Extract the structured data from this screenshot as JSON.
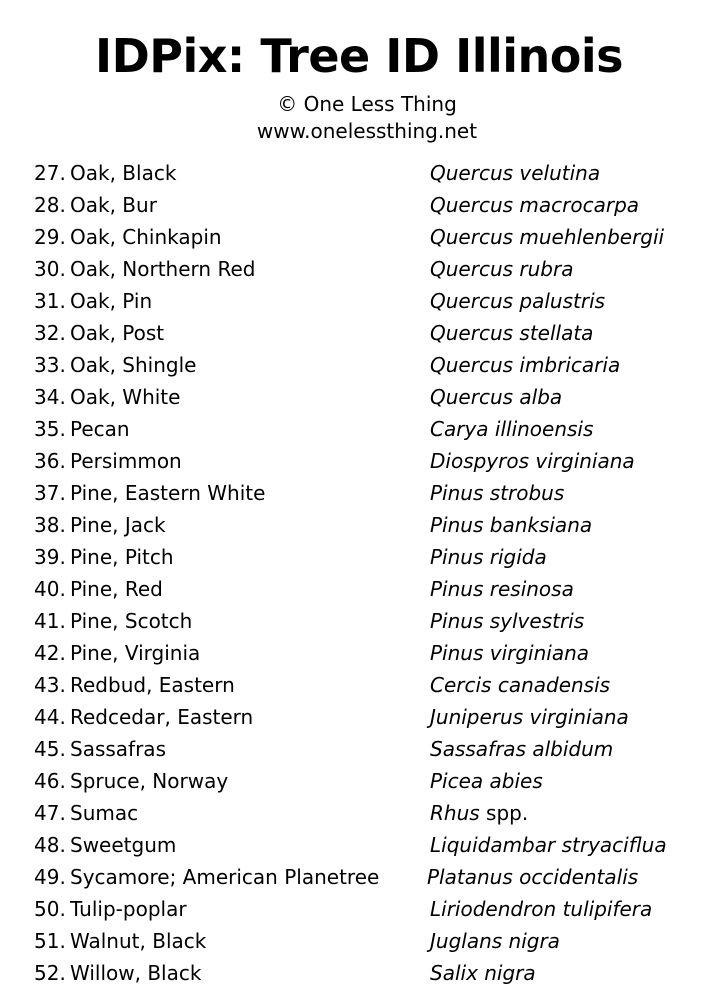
{
  "header": {
    "title": "IDPix: Tree ID Illinois",
    "copyright": "© One Less Thing",
    "website": "www.onelessthing.net"
  },
  "trees": [
    {
      "number": "27.",
      "common": "Oak, Black",
      "scientific": "Quercus velutina",
      "scientific_suffix": ""
    },
    {
      "number": "28.",
      "common": "Oak, Bur",
      "scientific": "Quercus macrocarpa",
      "scientific_suffix": ""
    },
    {
      "number": "29.",
      "common": "Oak, Chinkapin",
      "scientific": "Quercus muehlenbergii",
      "scientific_suffix": ""
    },
    {
      "number": "30.",
      "common": "Oak, Northern Red",
      "scientific": "Quercus rubra",
      "scientific_suffix": ""
    },
    {
      "number": "31.",
      "common": "Oak, Pin",
      "scientific": "Quercus palustris",
      "scientific_suffix": ""
    },
    {
      "number": "32.",
      "common": "Oak, Post",
      "scientific": "Quercus stellata",
      "scientific_suffix": ""
    },
    {
      "number": "33.",
      "common": "Oak, Shingle",
      "scientific": "Quercus imbricaria",
      "scientific_suffix": ""
    },
    {
      "number": "34.",
      "common": "Oak, White",
      "scientific": "Quercus alba",
      "scientific_suffix": ""
    },
    {
      "number": "35.",
      "common": "Pecan",
      "scientific": "Carya illinoensis",
      "scientific_suffix": ""
    },
    {
      "number": "36.",
      "common": "Persimmon",
      "scientific": "Diospyros virginiana",
      "scientific_suffix": ""
    },
    {
      "number": "37.",
      "common": "Pine, Eastern White",
      "scientific": "Pinus strobus",
      "scientific_suffix": ""
    },
    {
      "number": "38.",
      "common": "Pine, Jack",
      "scientific": "Pinus banksiana",
      "scientific_suffix": ""
    },
    {
      "number": "39.",
      "common": "Pine, Pitch",
      "scientific": "Pinus rigida",
      "scientific_suffix": ""
    },
    {
      "number": "40.",
      "common": "Pine, Red",
      "scientific": "Pinus resinosa",
      "scientific_suffix": ""
    },
    {
      "number": "41.",
      "common": "Pine, Scotch",
      "scientific": "Pinus sylvestris",
      "scientific_suffix": ""
    },
    {
      "number": "42.",
      "common": "Pine, Virginia",
      "scientific": "Pinus virginiana",
      "scientific_suffix": ""
    },
    {
      "number": "43.",
      "common": "Redbud, Eastern",
      "scientific": "Cercis canadensis",
      "scientific_suffix": ""
    },
    {
      "number": "44.",
      "common": "Redcedar, Eastern",
      "scientific": "Juniperus virginiana",
      "scientific_suffix": ""
    },
    {
      "number": "45.",
      "common": "Sassafras",
      "scientific": "Sassafras albidum",
      "scientific_suffix": ""
    },
    {
      "number": "46.",
      "common": "Spruce, Norway",
      "scientific": "Picea abies",
      "scientific_suffix": ""
    },
    {
      "number": "47.",
      "common": "Sumac",
      "scientific": "Rhus",
      "scientific_suffix": " spp."
    },
    {
      "number": "48.",
      "common": "Sweetgum",
      "scientific": "Liquidambar stryaciflua",
      "scientific_suffix": ""
    },
    {
      "number": "49.",
      "common": "Sycamore; American Planetree",
      "scientific": "Platanus occidentalis",
      "scientific_suffix": ""
    },
    {
      "number": "50.",
      "common": "Tulip-poplar",
      "scientific": "Liriodendron tulipifera",
      "scientific_suffix": ""
    },
    {
      "number": "51.",
      "common": "Walnut, Black",
      "scientific": "Juglans nigra",
      "scientific_suffix": ""
    },
    {
      "number": "52.",
      "common": "Willow, Black",
      "scientific": "Salix nigra",
      "scientific_suffix": ""
    }
  ]
}
